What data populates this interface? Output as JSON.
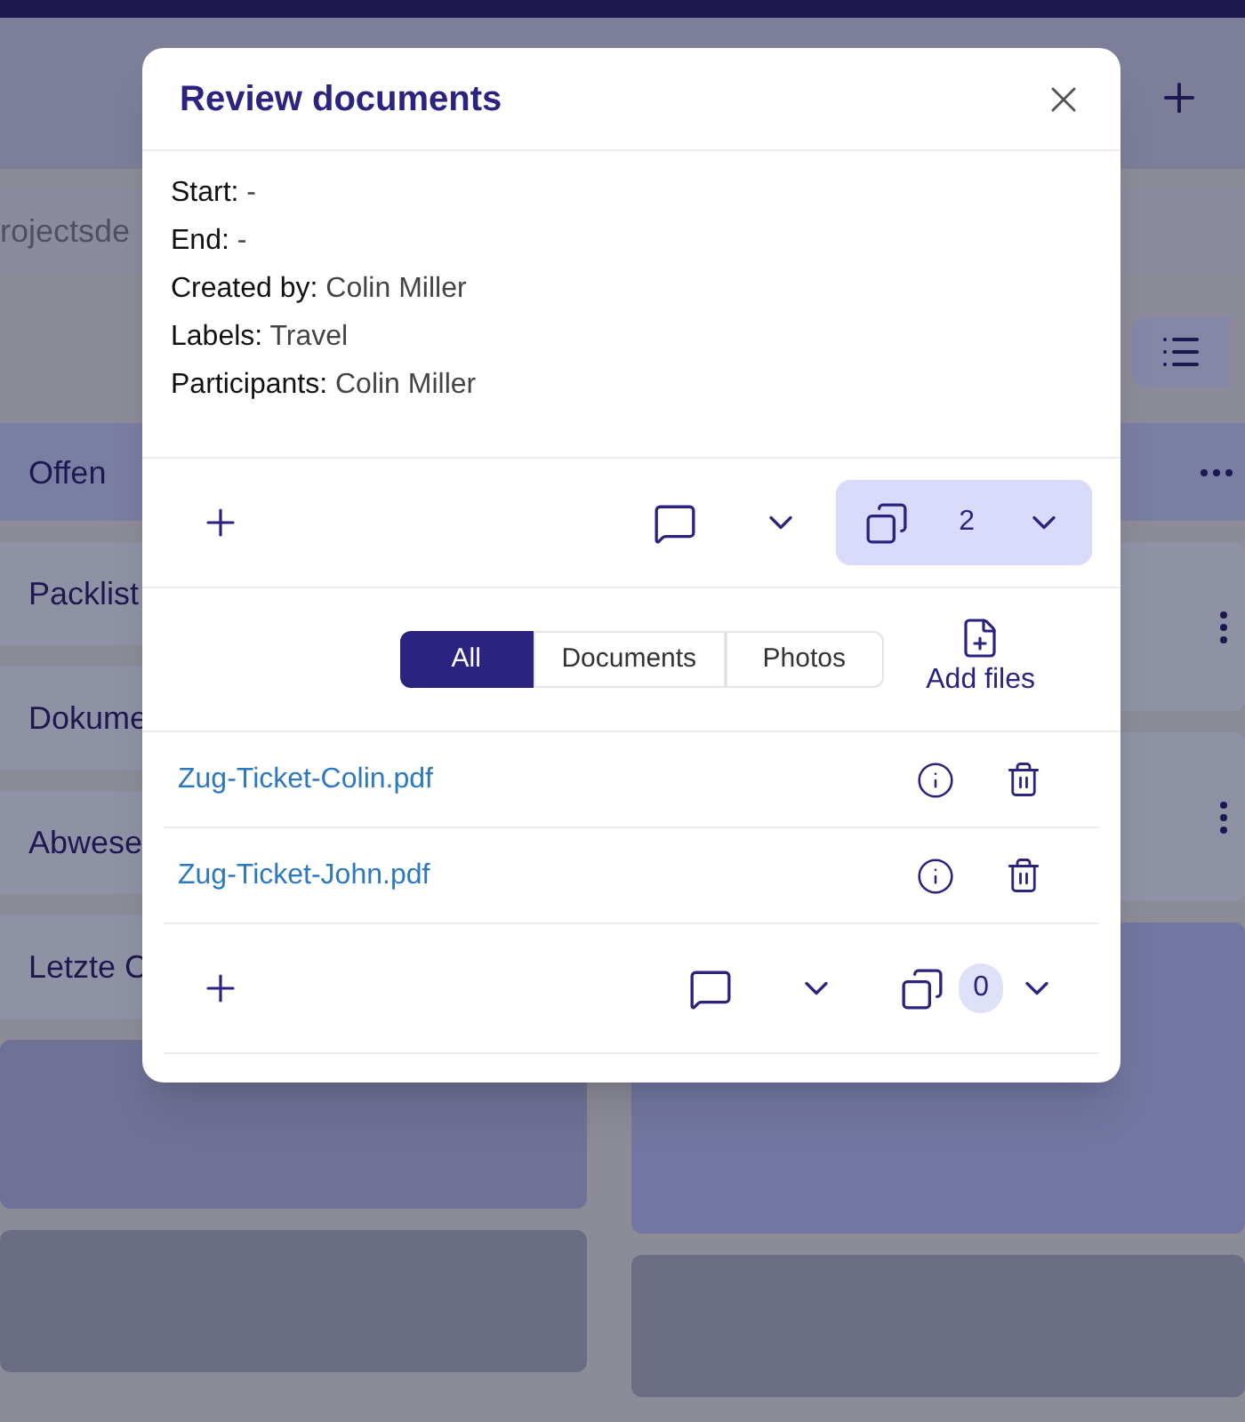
{
  "background": {
    "search_text": "rojectsde",
    "column_title": "Offen",
    "cards": [
      {
        "title": "Packlist"
      },
      {
        "title": "Dokume"
      },
      {
        "title": "Abwese"
      },
      {
        "title": "Letzte C"
      }
    ]
  },
  "dialog": {
    "title": "Review documents",
    "details": [
      "**Start:** -",
      "**End:** -",
      "**Created by:** Colin Miller",
      "**Labels:** Travel",
      "**Participants:** Colin Miller"
    ],
    "toolbar": {
      "documents_count": "2",
      "documents_open": true
    },
    "filters": [
      {
        "label": "All",
        "selected": true
      },
      {
        "label": "Documents",
        "selected": false
      },
      {
        "label": "Photos",
        "selected": false
      }
    ],
    "add_files": "Add files",
    "files": [
      {
        "name": "Zug-Ticket-Colin.pdf"
      },
      {
        "name": "Zug-Ticket-John.pdf"
      }
    ],
    "file_toolbar": {
      "documents_count": "0",
      "documents_open": false
    }
  }
}
